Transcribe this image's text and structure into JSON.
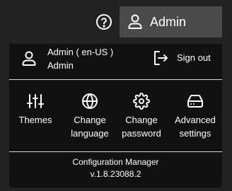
{
  "topbar": {
    "help_icon": "help-circle-icon",
    "account_button": {
      "label": "Admin",
      "icon": "user-icon"
    }
  },
  "menu": {
    "user": {
      "name": "Admin ( en-US )",
      "role": "Admin",
      "icon": "user-icon"
    },
    "sign_out": {
      "label": "Sign out",
      "icon": "sign-out-icon"
    },
    "actions": [
      {
        "label": "Themes",
        "icon": "sliders-icon"
      },
      {
        "label": "Change\nlanguage",
        "icon": "globe-icon"
      },
      {
        "label": "Change\npassword",
        "icon": "gear-icon"
      },
      {
        "label": "Advanced\nsettings",
        "icon": "drive-icon"
      }
    ],
    "footer": {
      "app_name": "Configuration Manager",
      "version": "v.1.8.23088.2"
    }
  },
  "colors": {
    "background": "#222222",
    "panel": "#111111",
    "account_button": "#4a4a4a",
    "text": "#ffffff",
    "divider": "#d8d8d8"
  }
}
